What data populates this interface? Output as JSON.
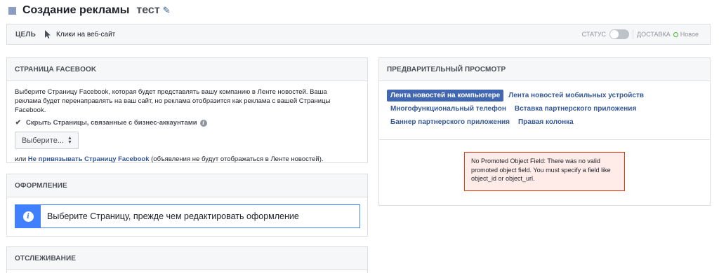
{
  "header": {
    "title": "Создание рекламы",
    "campaign_name": "тест",
    "edit_icon": "pencil-icon"
  },
  "goal_bar": {
    "label": "ЦЕЛЬ",
    "value": "Клики на веб-сайт",
    "status_label": "СТАТУС",
    "status_on": false,
    "delivery_label": "ДОСТАВКА",
    "delivery_value": "Новое",
    "delivery_color": "#42b72a"
  },
  "facebook_page": {
    "header": "СТРАНИЦА FACEBOOK",
    "description": "Выберите Страницу Facebook, которая будет представлять вашу компанию в Ленте новостей. Ваша реклама будет перенаправлять на ваш сайт, но реклама отобразится как реклама с вашей Страницы Facebook.",
    "checkbox_label": "Скрыть Страницы, связанные с бизнес-аккаунтами",
    "checkbox_checked": true,
    "select_label": "Выберите...",
    "unlink_prefix": "или ",
    "unlink_link": "Не привязывать Страницу Facebook",
    "unlink_suffix": " (объявления не будут отображаться в Ленте новостей)."
  },
  "design": {
    "header": "ОФОРМЛЕНИЕ",
    "info_message": "Выберите Страницу, прежде чем редактировать оформление"
  },
  "tracking": {
    "header": "ОТСЛЕЖИВАНИЕ"
  },
  "preview": {
    "header": "ПРЕДВАРИТЕЛЬНЫЙ ПРОСМОТР",
    "tabs": [
      "Лента новостей на компьютере",
      "Лента новостей мобильных устройств",
      "Многофункциональный телефон",
      "Вставка партнерского приложения",
      "Баннер партнерского приложения",
      "Правая колонка"
    ],
    "active_tab": 0,
    "error_message": "No Promoted Object Field: There was no valid promoted object field. You must specify a field like object_id or object_url."
  },
  "colors": {
    "accent": "#4267b2",
    "link": "#365899",
    "info": "#4080ff",
    "error_bg": "#ffebe8",
    "error_border": "#dd3c10"
  }
}
